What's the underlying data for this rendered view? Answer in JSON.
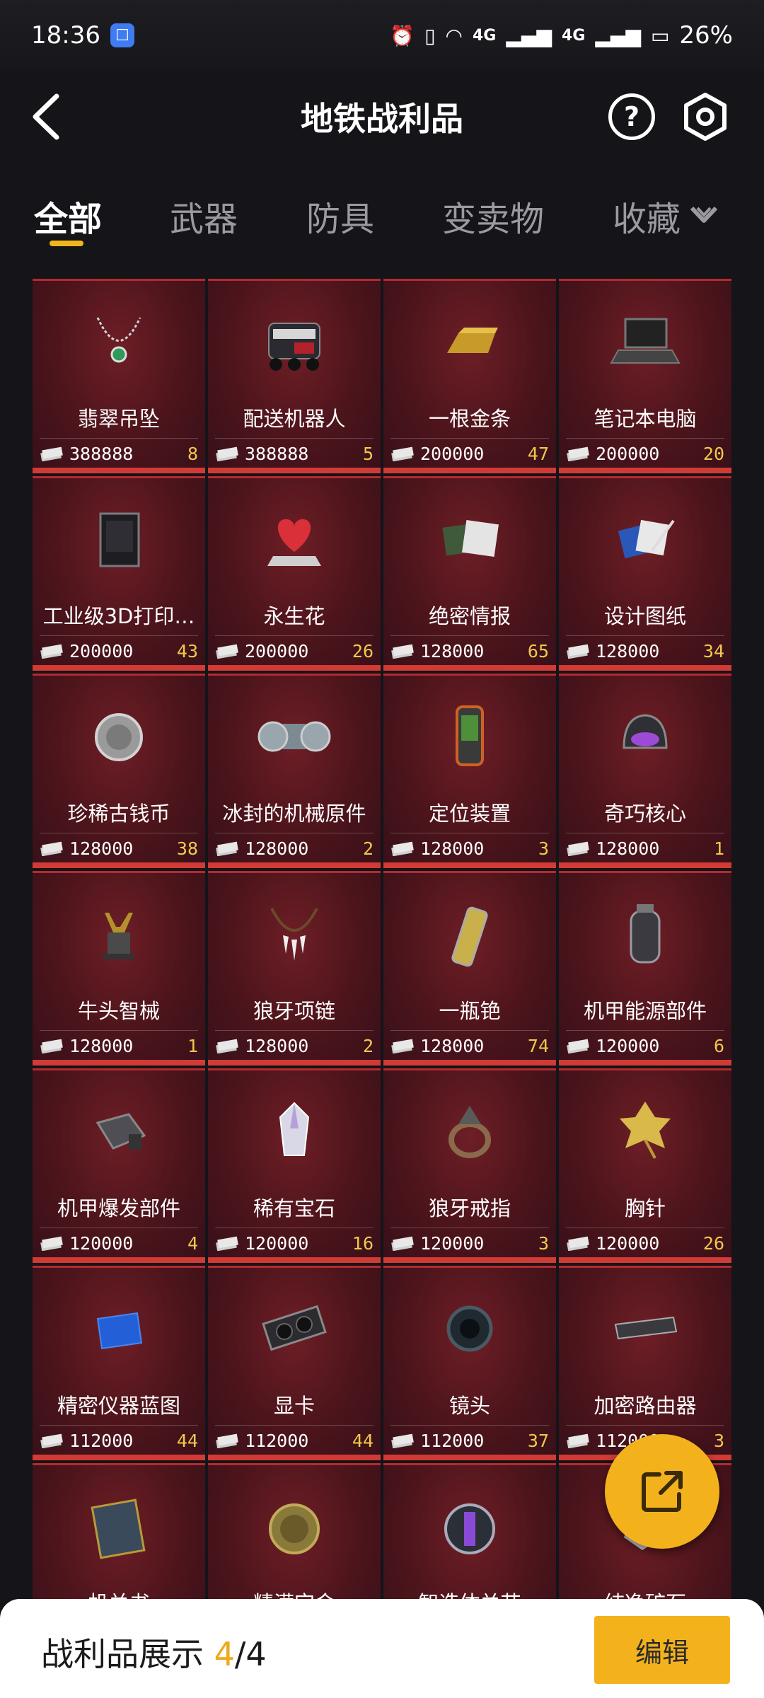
{
  "status_bar": {
    "time": "18:36",
    "app_badge": "☐",
    "net1": "4G",
    "net2": "4G",
    "battery": "26%"
  },
  "header": {
    "title": "地铁战利品"
  },
  "tabs": [
    {
      "label": "全部",
      "active": true
    },
    {
      "label": "武器",
      "active": false
    },
    {
      "label": "防具",
      "active": false
    },
    {
      "label": "变卖物",
      "active": false
    },
    {
      "label": "收藏",
      "active": false
    }
  ],
  "items": [
    {
      "name": "翡翠吊坠",
      "price": "388888",
      "count": "8",
      "icon": "necklace-icon"
    },
    {
      "name": "配送机器人",
      "price": "388888",
      "count": "5",
      "icon": "robot-icon"
    },
    {
      "name": "一根金条",
      "price": "200000",
      "count": "47",
      "icon": "gold-bar-icon"
    },
    {
      "name": "笔记本电脑",
      "price": "200000",
      "count": "20",
      "icon": "laptop-icon"
    },
    {
      "name": "工业级3D打印…",
      "price": "200000",
      "count": "43",
      "icon": "3d-printer-icon"
    },
    {
      "name": "永生花",
      "price": "200000",
      "count": "26",
      "icon": "heart-flower-icon"
    },
    {
      "name": "绝密情报",
      "price": "128000",
      "count": "65",
      "icon": "secret-docs-icon"
    },
    {
      "name": "设计图纸",
      "price": "128000",
      "count": "34",
      "icon": "blueprint-icon"
    },
    {
      "name": "珍稀古钱币",
      "price": "128000",
      "count": "38",
      "icon": "coin-icon"
    },
    {
      "name": "冰封的机械原件",
      "price": "128000",
      "count": "2",
      "icon": "mech-part-icon"
    },
    {
      "name": "定位装置",
      "price": "128000",
      "count": "3",
      "icon": "gps-icon"
    },
    {
      "name": "奇巧核心",
      "price": "128000",
      "count": "1",
      "icon": "core-helmet-icon"
    },
    {
      "name": "牛头智械",
      "price": "128000",
      "count": "1",
      "icon": "bull-figure-icon"
    },
    {
      "name": "狼牙项链",
      "price": "128000",
      "count": "2",
      "icon": "tooth-necklace-icon"
    },
    {
      "name": "一瓶铯",
      "price": "128000",
      "count": "74",
      "icon": "vial-icon"
    },
    {
      "name": "机甲能源部件",
      "price": "120000",
      "count": "6",
      "icon": "canister-icon"
    },
    {
      "name": "机甲爆发部件",
      "price": "120000",
      "count": "4",
      "icon": "boost-part-icon"
    },
    {
      "name": "稀有宝石",
      "price": "120000",
      "count": "16",
      "icon": "gem-icon"
    },
    {
      "name": "狼牙戒指",
      "price": "120000",
      "count": "3",
      "icon": "ring-icon"
    },
    {
      "name": "胸针",
      "price": "120000",
      "count": "26",
      "icon": "leaf-brooch-icon"
    },
    {
      "name": "精密仪器蓝图",
      "price": "112000",
      "count": "44",
      "icon": "blue-blueprint-icon"
    },
    {
      "name": "显卡",
      "price": "112000",
      "count": "44",
      "icon": "gpu-icon"
    },
    {
      "name": "镜头",
      "price": "112000",
      "count": "37",
      "icon": "lens-icon"
    },
    {
      "name": "加密路由器",
      "price": "112000",
      "count": "3",
      "icon": "router-icon"
    },
    {
      "name": "机关书",
      "price": "",
      "count": "",
      "icon": "book-icon"
    },
    {
      "name": "精满宝金",
      "price": "",
      "count": "",
      "icon": "medallion-icon"
    },
    {
      "name": "智造体关节",
      "price": "",
      "count": "",
      "icon": "orb-icon"
    },
    {
      "name": "纯净矿石",
      "price": "",
      "count": "",
      "icon": "ore-icon"
    }
  ],
  "bottom_bar": {
    "label": "战利品展示",
    "current": "4",
    "total": "/4",
    "edit_label": "编辑"
  },
  "colors": {
    "accent": "#f3b21c",
    "card_red": "#d23b35"
  }
}
